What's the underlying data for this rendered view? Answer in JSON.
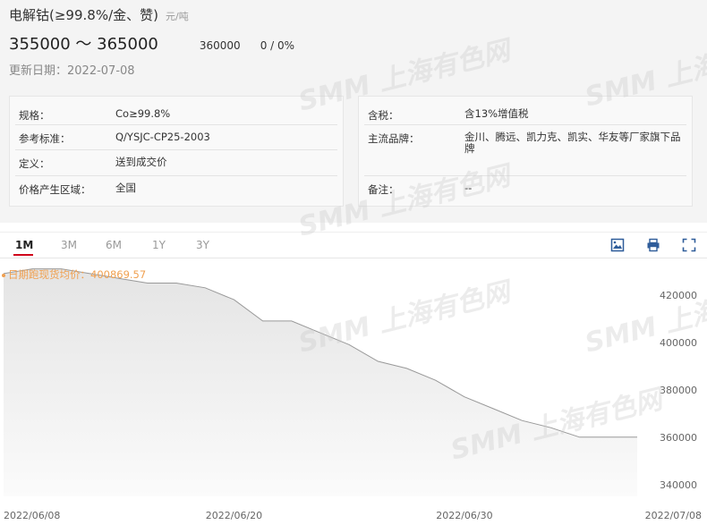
{
  "header": {
    "title": "电解钴(≥99.8%/金、赞)",
    "unit": "元/吨",
    "price_range": "355000 ～ 365000",
    "avg_price": "360000",
    "change": "0 / 0%",
    "update_date": "更新日期：2022-07-08"
  },
  "info_left": [
    {
      "key": "规格：",
      "value": "Co≥99.8%"
    },
    {
      "key": "参考标准：",
      "value": "Q/YSJC-CP25-2003"
    },
    {
      "key": "定义：",
      "value": "送到成交价"
    },
    {
      "key": "价格产生区域：",
      "value": "全国"
    }
  ],
  "info_right": [
    {
      "key": "含税：",
      "value": "含13%增值税"
    },
    {
      "key": "主流品牌：",
      "value": "金川、腾远、凯力克、凯实、华友等厂家旗下品牌"
    },
    {
      "key": "备注：",
      "value": "--"
    }
  ],
  "tabs": [
    {
      "label": "1M",
      "active": true
    },
    {
      "label": "3M",
      "active": false
    },
    {
      "label": "6M",
      "active": false
    },
    {
      "label": "1Y",
      "active": false
    },
    {
      "label": "3Y",
      "active": false
    }
  ],
  "tools": {
    "download": "download-image-icon",
    "print": "print-icon",
    "fullscreen": "fullscreen-icon"
  },
  "watermark": "SMM 上海有色网",
  "chart_data": {
    "type": "area",
    "legend": "日期跑现货均价：400869.57",
    "x": [
      "2022-06-08",
      "2022-06-09",
      "2022-06-10",
      "2022-06-13",
      "2022-06-14",
      "2022-06-15",
      "2022-06-16",
      "2022-06-17",
      "2022-06-20",
      "2022-06-21",
      "2022-06-22",
      "2022-06-23",
      "2022-06-24",
      "2022-06-27",
      "2022-06-28",
      "2022-06-29",
      "2022-06-30",
      "2022-07-01",
      "2022-07-04",
      "2022-07-05",
      "2022-07-06",
      "2022-07-07",
      "2022-07-08"
    ],
    "values": [
      429000,
      431000,
      431000,
      429000,
      427000,
      425000,
      425000,
      423000,
      418000,
      409000,
      409000,
      404000,
      399000,
      392000,
      389000,
      384000,
      377000,
      372000,
      367000,
      364000,
      360000,
      360000,
      360000
    ],
    "x_tick_labels": [
      "2022/06/08",
      "2022/06/20",
      "2022/06/30",
      "2022/07/08"
    ],
    "x_tick_index": [
      0,
      8,
      16,
      22
    ],
    "y_ticks": [
      340000,
      360000,
      380000,
      400000,
      420000
    ],
    "ylim": [
      335000,
      435000
    ],
    "grid": false,
    "line_color": "#999999",
    "fill_color": "#e4e4e4"
  }
}
